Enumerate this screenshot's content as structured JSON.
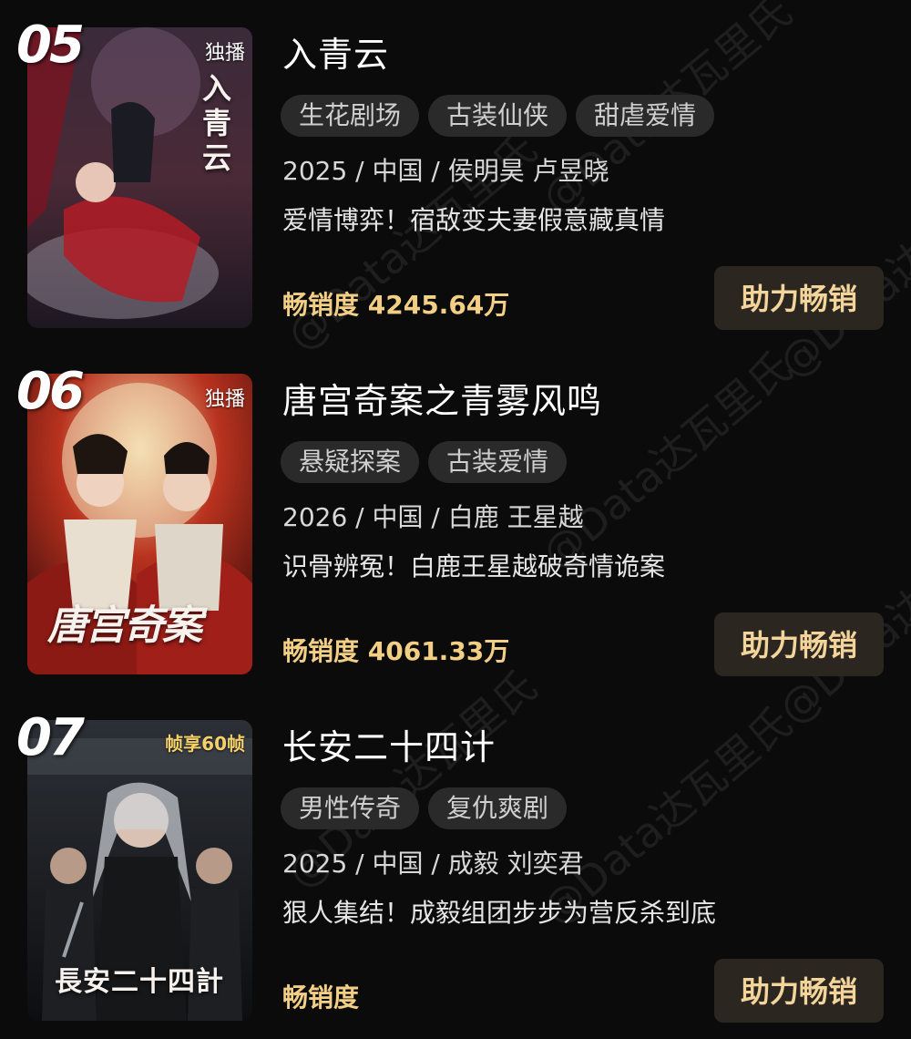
{
  "items": [
    {
      "rank": "05",
      "badge": "独播",
      "poster_title": "入青云",
      "title": "入青云",
      "tags": [
        "生花剧场",
        "古装仙侠",
        "甜虐爱情"
      ],
      "meta": "2025 / 中国 / 侯明昊 卢昱晓",
      "desc": "爱情博弈！宿敌变夫妻假意藏真情",
      "sales": "畅销度 4245.64万",
      "button": "助力畅销"
    },
    {
      "rank": "06",
      "badge": "独播",
      "poster_title": "唐宫奇案",
      "title": "唐宫奇案之青雾风鸣",
      "tags": [
        "悬疑探案",
        "古装爱情"
      ],
      "meta": "2026 / 中国 / 白鹿 王星越",
      "desc": "识骨辨冤！白鹿王星越破奇情诡案",
      "sales": "畅销度 4061.33万",
      "button": "助力畅销"
    },
    {
      "rank": "07",
      "badge": "帧享60帧",
      "poster_title": "長安二十四計",
      "title": "长安二十四计",
      "tags": [
        "男性传奇",
        "复仇爽剧"
      ],
      "meta": "2025 / 中国 / 成毅 刘奕君",
      "desc": "狠人集结！成毅组团步步为营反杀到底",
      "sales": "畅销度",
      "button": "助力畅销"
    }
  ],
  "watermark": "@Data达瓦里氏"
}
